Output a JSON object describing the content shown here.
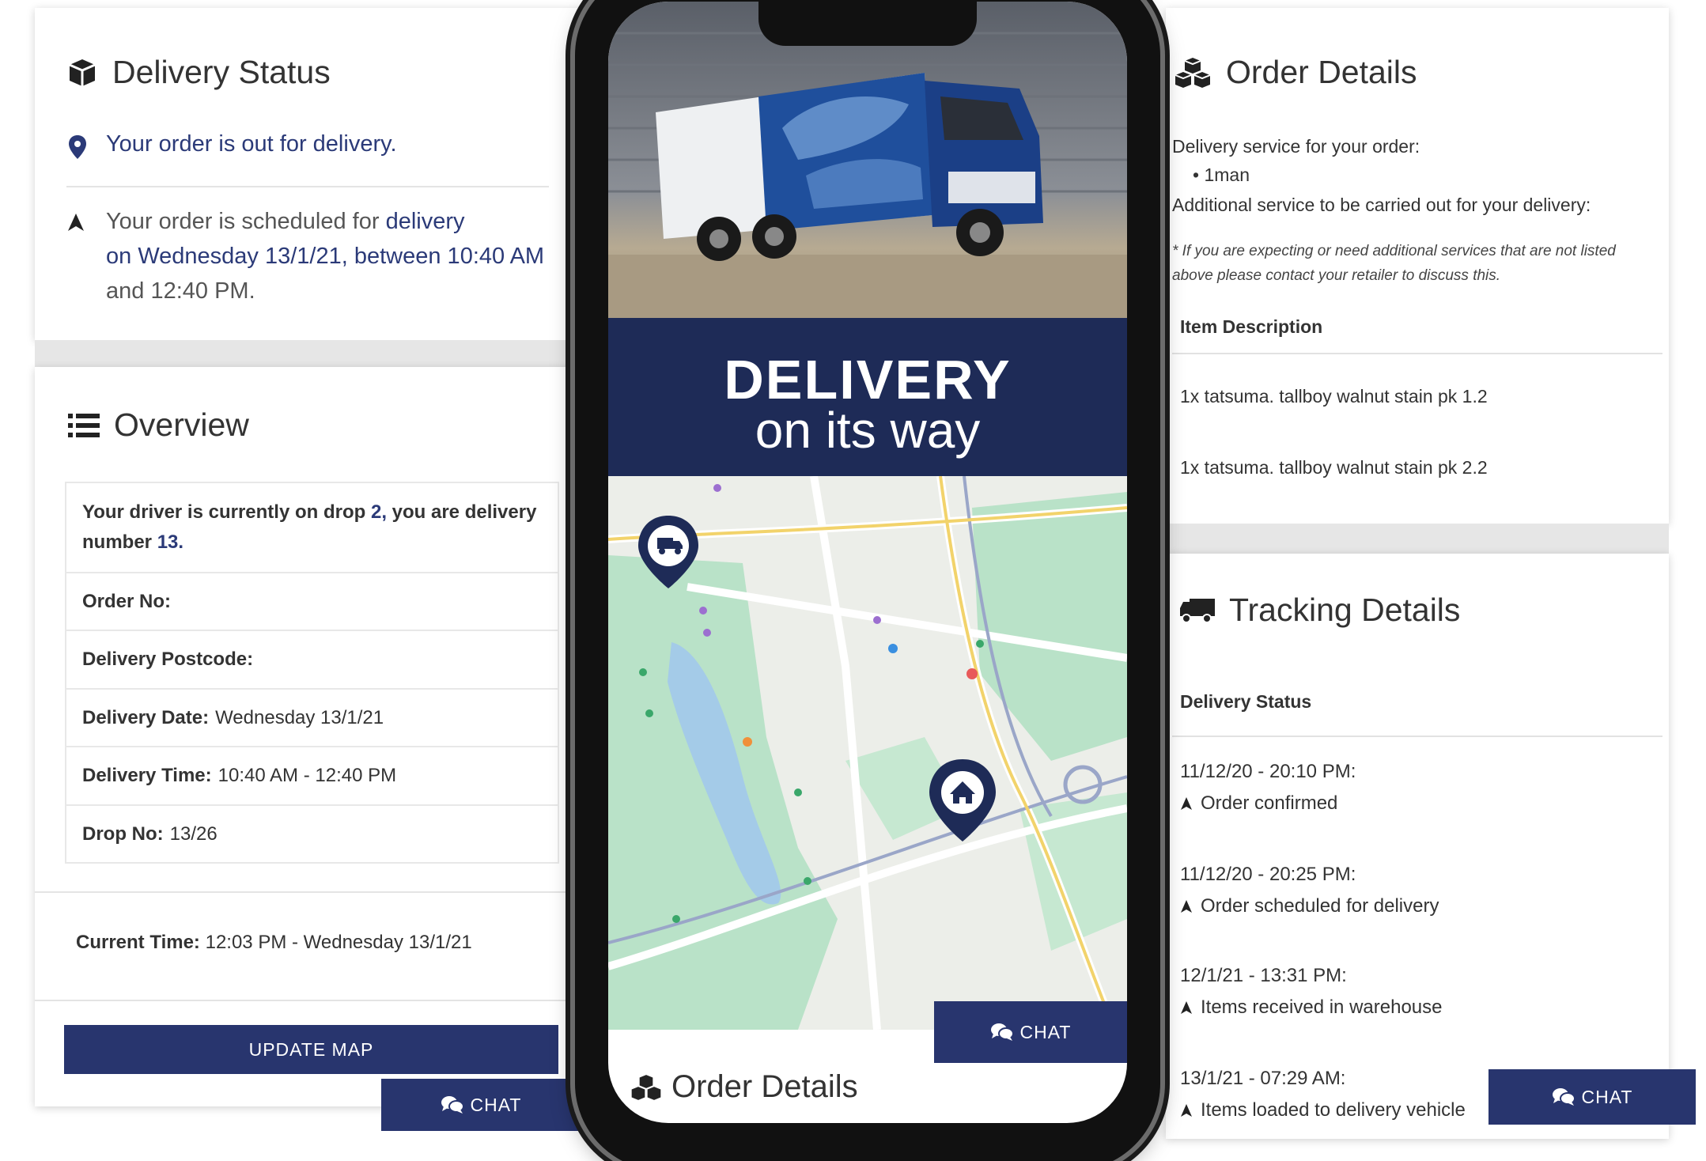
{
  "delivery_status": {
    "title": "Delivery Status",
    "line1": "Your order is out for delivery.",
    "line2a_pre": "Your  order is scheduled for ",
    "line2a_hl": "delivery",
    "line2b": "on Wednesday 13/1/21, between 10:40 AM",
    "line2c": "and 12:40 PM."
  },
  "overview": {
    "title": "Overview",
    "driver_pre": "Your driver is currently on drop",
    "driver_drop": "2,",
    "driver_mid": "you are delivery",
    "driver_mid2": "number",
    "driver_num": "13.",
    "order_no_label": "Order No:",
    "postcode_label": "Delivery Postcode:",
    "date_label": "Delivery Date:",
    "date_value": "Wednesday 13/1/21",
    "time_label": "Delivery Time:",
    "time_value": "10:40 AM - 12:40 PM",
    "drop_label": "Drop No:",
    "drop_value": "13/26",
    "current_time_label": "Current Time:",
    "current_time_value": "12:03 PM - Wednesday 13/1/21",
    "update_map": "UPDATE MAP",
    "chat": "CHAT"
  },
  "phone": {
    "banner_line1": "DELIVERY",
    "banner_line2": "on its way",
    "chat": "CHAT",
    "order_details_partial": "Order Details"
  },
  "order_details": {
    "title": "Order Details",
    "service_label": "Delivery service for your order:",
    "service_item": "1man",
    "additional_label": "Additional service to be carried out for your delivery:",
    "note_line1": "* If you are expecting or need additional services that are not listed",
    "note_line2": "above please contact your retailer to discuss this.",
    "item_header": "Item Description",
    "items": [
      "1x tatsuma. tallboy walnut stain pk 1.2",
      "1x tatsuma. tallboy walnut stain pk 2.2"
    ]
  },
  "tracking": {
    "title": "Tracking Details",
    "status_header": "Delivery Status",
    "events": [
      {
        "time": "11/12/20 - 20:10 PM:",
        "desc": "Order confirmed"
      },
      {
        "time": "11/12/20 - 20:25 PM:",
        "desc": "Order scheduled for delivery"
      },
      {
        "time": "12/1/21 - 13:31 PM:",
        "desc": "Items received in warehouse"
      },
      {
        "time": "13/1/21 - 07:29 AM:",
        "desc": "Items loaded to delivery vehicle"
      }
    ],
    "chat": "CHAT"
  },
  "colors": {
    "brand_navy": "#28356e",
    "banner_navy": "#1e2b57",
    "highlight_text": "#2b3a78"
  }
}
